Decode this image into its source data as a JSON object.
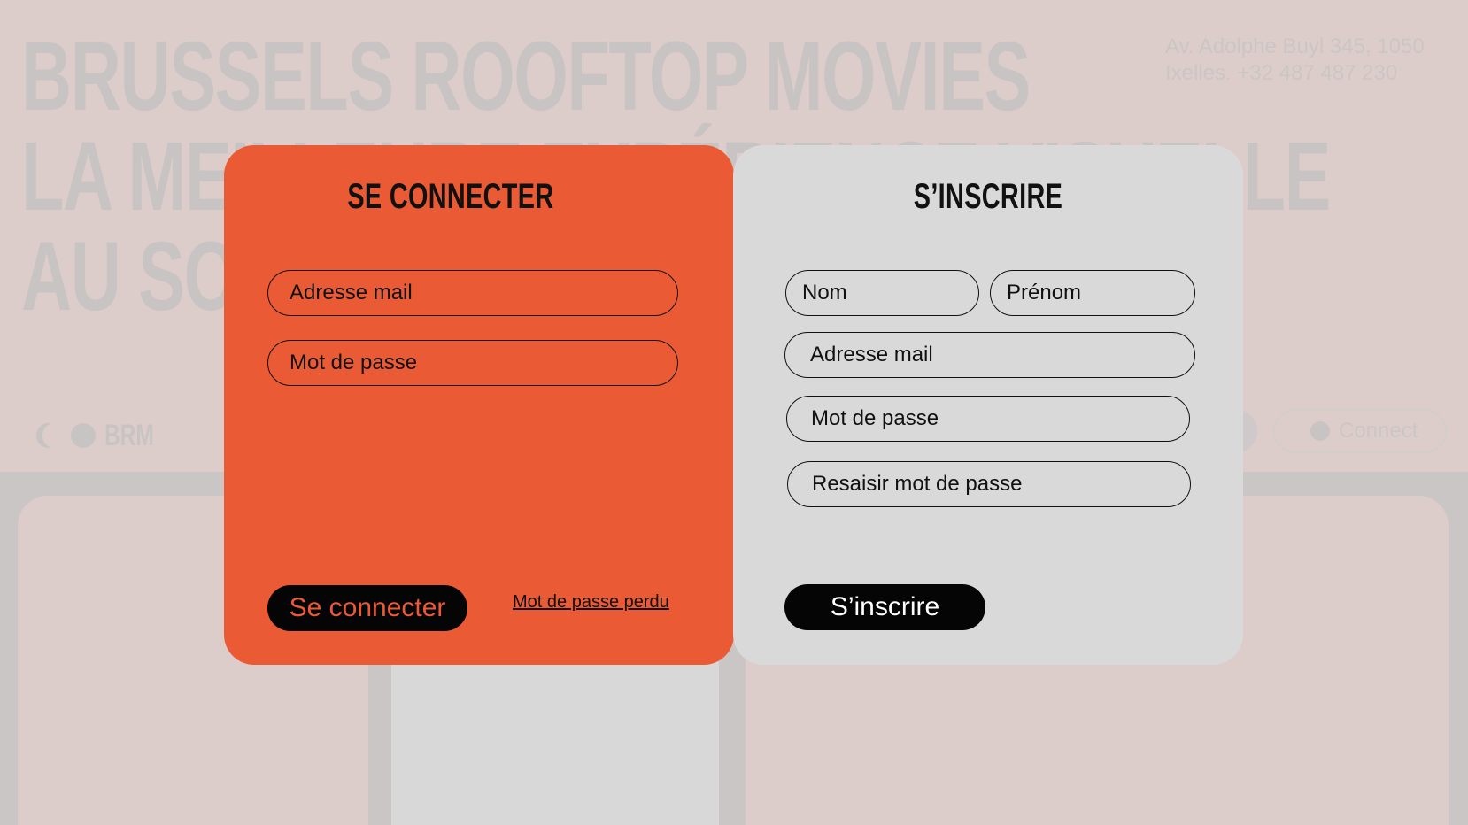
{
  "background": {
    "hero_lines": [
      "BRUSSELS ROOFTOP MOVIES",
      "LA MEILLEURE EXPÉRIENCE VISUELLE",
      "AU SOMMET"
    ],
    "address_line1": "Av. Adolphe Buyl 345, 1050",
    "address_line2": "Ixelles. +32 487 487 230",
    "logo_text": "BRM",
    "connect_label": "Connect"
  },
  "login": {
    "title": "SE CONNECTER",
    "email_placeholder": "Adresse mail",
    "password_placeholder": "Mot de passe",
    "submit_label": "Se connecter",
    "forgot_label": "Mot de passe perdu"
  },
  "signup": {
    "title": "S’INSCRIRE",
    "lastname_placeholder": "Nom",
    "firstname_placeholder": "Prénom",
    "email_placeholder": "Adresse mail",
    "password_placeholder": "Mot de passe",
    "confirm_placeholder": "Resaisir mot de passe",
    "submit_label": "S’inscrire"
  },
  "colors": {
    "login_panel": "#ea5a35",
    "signup_panel": "#d9d9d9",
    "button": "#050505"
  }
}
